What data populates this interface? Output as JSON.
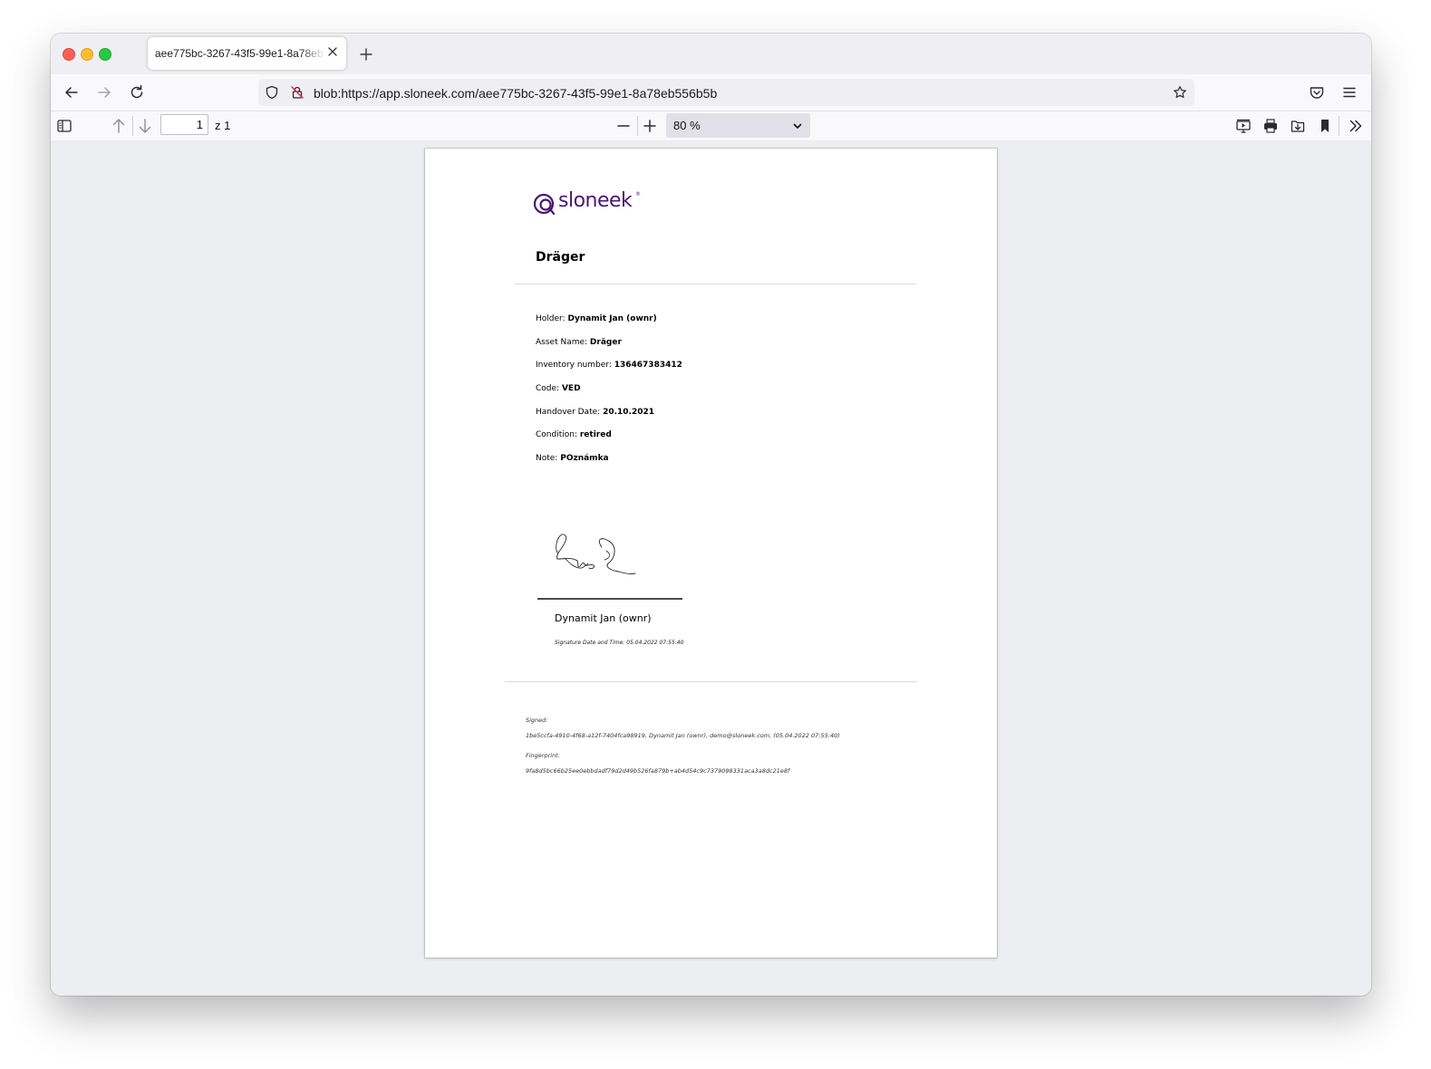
{
  "browser": {
    "tab_title": "aee775bc-3267-43f5-99e1-8a78eb556b5b",
    "url": "blob:https://app.sloneek.com/aee775bc-3267-43f5-99e1-8a78eb556b5b"
  },
  "pdf_toolbar": {
    "page_number": "1",
    "page_of": "z 1",
    "zoom": "80 %"
  },
  "document": {
    "logo_text": "sloneek",
    "title": "Dräger",
    "fields": [
      {
        "label": "Holder:",
        "value": "Dynamit Jan (ownr)"
      },
      {
        "label": "Asset Name:",
        "value": "Dräger"
      },
      {
        "label": "Inventory number:",
        "value": "136467383412"
      },
      {
        "label": "Code:",
        "value": "VED"
      },
      {
        "label": "Handover Date:",
        "value": "20.10.2021"
      },
      {
        "label": "Condition:",
        "value": "retired"
      },
      {
        "label": "Note:",
        "value": "POznámka"
      }
    ],
    "signer_name": "Dynamit Jan (ownr)",
    "signature_datetime": "Signature Date and Time: 05.04.2022 07:55:40",
    "signed_label": "Signed:",
    "signed_value": "1be5ccfa-4910-4f68-a12f-7404fca98919, Dynamit Jan (ownr), demo@sloneek.com, (05.04.2022 07:55:40)",
    "fingerprint_label": "Fingerprint:",
    "fingerprint_value": "9fa8d5bc66b25ee0ebbdadf79d2d49b526fa879b+ab4d54c9c7379098331aca3a8dc21e8f"
  },
  "colors": {
    "brand": "#4a1772",
    "viewer_bg": "#edeef2"
  }
}
